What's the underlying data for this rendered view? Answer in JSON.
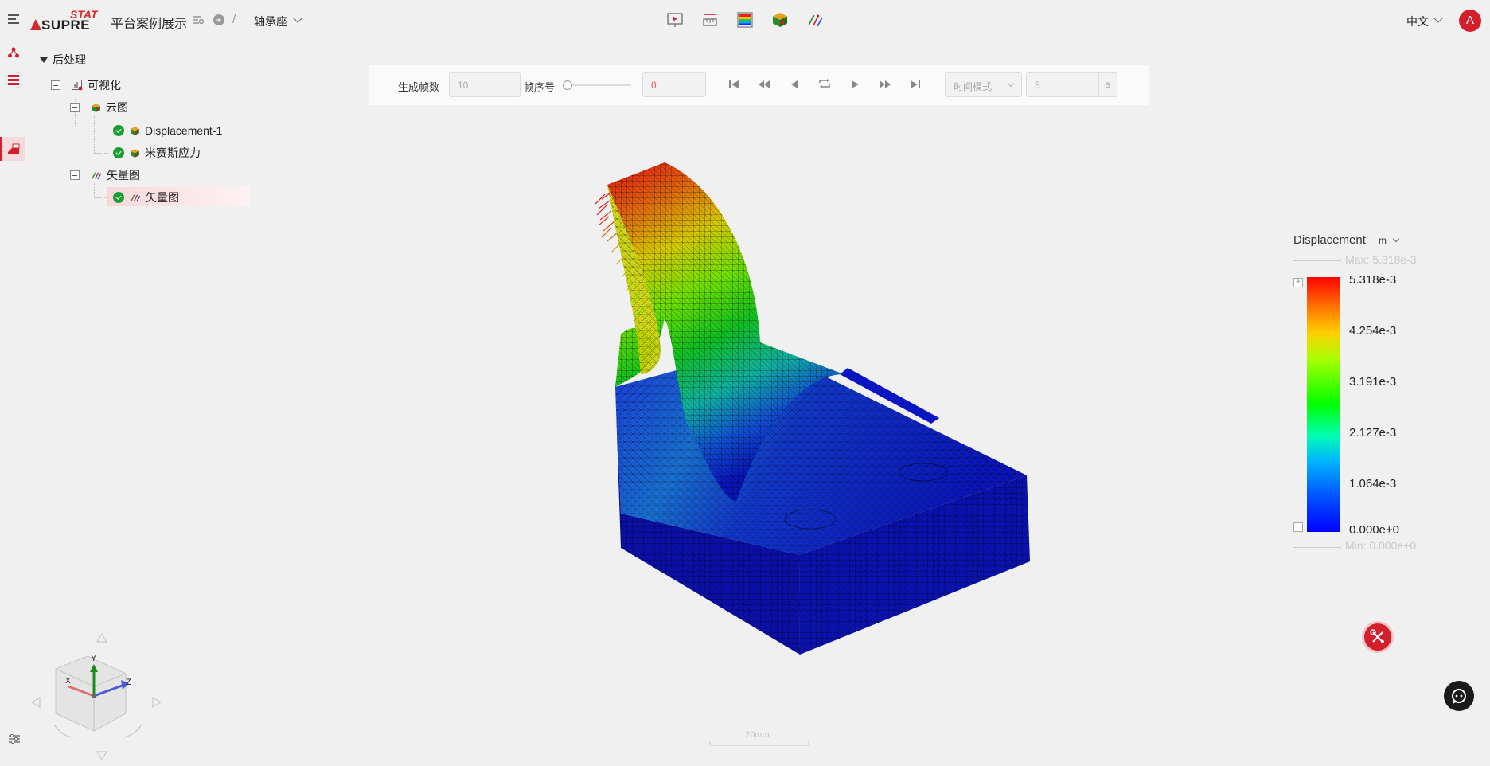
{
  "header": {
    "logo_top": "STAT",
    "logo_bottom": "SUPRE",
    "project_title": "平台案例展示",
    "breadcrumb_sep": "/",
    "model_name": "轴承座",
    "language": "中文",
    "avatar_letter": "A",
    "toolbar_icons": [
      "probe-icon",
      "ruler-icon",
      "color-map-icon",
      "contour-cube-icon",
      "vector-icon"
    ]
  },
  "tree": {
    "root": "后处理",
    "visualization": "可视化",
    "contour_group": "云图",
    "contour_items": [
      "Displacement-1",
      "米赛斯应力"
    ],
    "vector_group": "矢量图",
    "vector_items": [
      "矢量图"
    ]
  },
  "animation": {
    "frames_label": "生成帧数",
    "frames_value": "10",
    "frame_index_label": "帧序号",
    "frame_index_value": "0",
    "mode": "时间模式",
    "duration": "5",
    "duration_unit": "s"
  },
  "legend": {
    "title": "Displacement",
    "unit": "m",
    "max_label": "Max: 5.318e-3",
    "min_label": "Min: 0.000e+0",
    "ticks": [
      "5.318e-3",
      "4.254e-3",
      "3.191e-3",
      "2.127e-3",
      "1.064e-3",
      "0.000e+0"
    ],
    "expand_glyph": "+",
    "collapse_glyph": "−",
    "colors": [
      "#ff0000",
      "#ffd000",
      "#00ff00",
      "#00ffb0",
      "#0060ff",
      "#0000ff"
    ]
  },
  "viewport": {
    "scale_label": "20mm",
    "axes": {
      "x": "X",
      "y": "Y",
      "z": "Z"
    }
  },
  "colors": {
    "accent": "#d21f2b",
    "success": "#1a9d33",
    "mesh_base": "#0a14b8"
  }
}
